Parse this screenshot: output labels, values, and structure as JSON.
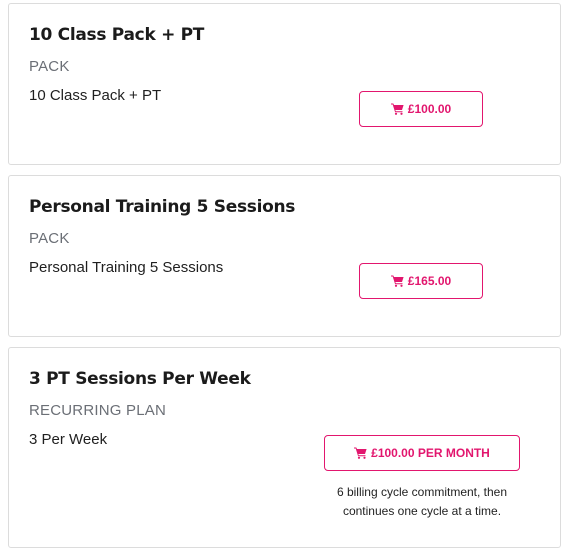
{
  "products": [
    {
      "title": "10 Class Pack + PT",
      "type": "PACK",
      "description": "10 Class Pack + PT",
      "price_label": "£100.00"
    },
    {
      "title": "Personal Training 5 Sessions",
      "type": "PACK",
      "description": "Personal Training 5 Sessions",
      "price_label": "£165.00"
    },
    {
      "title": "3 PT Sessions Per Week",
      "type": "RECURRING PLAN",
      "description": "3 Per Week",
      "price_label": "£100.00 PER MONTH",
      "note": "6 billing cycle commitment, then continues one cycle at a time."
    }
  ],
  "icons": {
    "cart": "shopping-cart-icon"
  },
  "colors": {
    "accent": "#e2166e",
    "muted_text": "#6b6f76",
    "card_border": "#dcdcdc"
  }
}
